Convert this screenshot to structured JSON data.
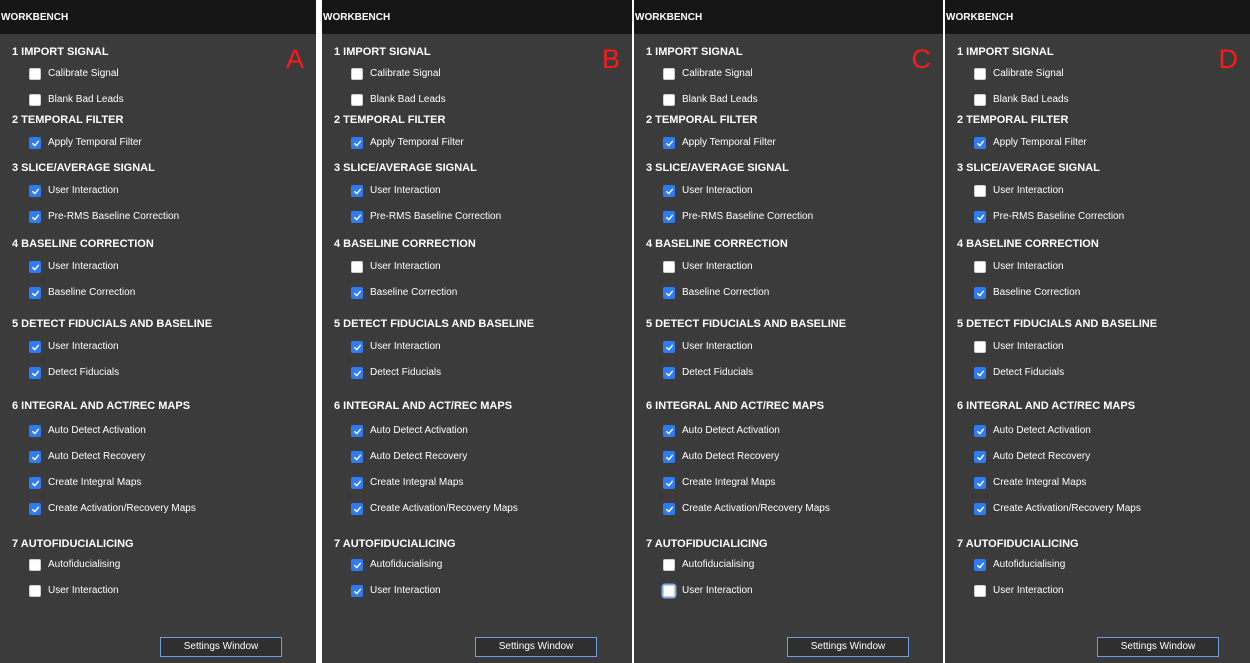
{
  "window_title": "WORKBENCH",
  "settings_label": "Settings Window",
  "sections": [
    {
      "title": "1 IMPORT SIGNAL",
      "items": [
        "Calibrate Signal",
        "Blank Bad Leads"
      ]
    },
    {
      "title": "2  TEMPORAL FILTER",
      "items": [
        "Apply Temporal Filter"
      ]
    },
    {
      "title": "3  SLICE/AVERAGE SIGNAL",
      "items": [
        "User Interaction",
        "Pre-RMS Baseline Correction"
      ]
    },
    {
      "title": "4  BASELINE CORRECTION",
      "items": [
        "User Interaction",
        "Baseline Correction"
      ]
    },
    {
      "title": "5  DETECT FIDUCIALS AND BASELINE",
      "items": [
        "User Interaction",
        "Detect Fiducials"
      ]
    },
    {
      "title": "6  INTEGRAL AND ACT/REC MAPS",
      "items": [
        "Auto Detect Activation",
        "Auto Detect Recovery",
        "Create Integral Maps",
        "Create Activation/Recovery Maps"
      ]
    },
    {
      "title": "7  AUTOFIDUCIALICING",
      "items": [
        "Autofiducialising",
        "User Interaction"
      ]
    }
  ],
  "panels": [
    {
      "letter": "A",
      "checked": [
        [
          false,
          false
        ],
        [
          true
        ],
        [
          true,
          true
        ],
        [
          true,
          true
        ],
        [
          true,
          true
        ],
        [
          true,
          true,
          true,
          true
        ],
        [
          false,
          false
        ]
      ]
    },
    {
      "letter": "B",
      "checked": [
        [
          false,
          false
        ],
        [
          true
        ],
        [
          true,
          true
        ],
        [
          false,
          true
        ],
        [
          true,
          true
        ],
        [
          true,
          true,
          true,
          true
        ],
        [
          true,
          true
        ]
      ]
    },
    {
      "letter": "C",
      "checked": [
        [
          false,
          false
        ],
        [
          true
        ],
        [
          true,
          true
        ],
        [
          false,
          true
        ],
        [
          true,
          true
        ],
        [
          true,
          true,
          true,
          true
        ],
        [
          false,
          false
        ]
      ]
    },
    {
      "letter": "D",
      "checked": [
        [
          false,
          false
        ],
        [
          true
        ],
        [
          false,
          true
        ],
        [
          false,
          true
        ],
        [
          false,
          true
        ],
        [
          true,
          true,
          true,
          true
        ],
        [
          true,
          false
        ]
      ]
    }
  ],
  "colors": {
    "panel_bg": "#3b3b3b",
    "titlebar_bg": "#161616",
    "checkbox_checked": "#2f7bf3",
    "letter_color": "#ff1a1a",
    "button_border": "#6f9de2"
  },
  "icons": {
    "check": "checkmark-icon"
  }
}
